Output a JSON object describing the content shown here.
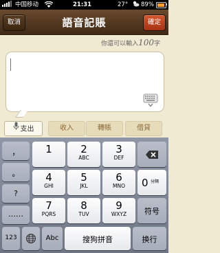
{
  "status_bar": {
    "carrier": "中国移动",
    "time": "21:31",
    "temperature": "27°",
    "battery": "89%",
    "battery_level": 0.89
  },
  "nav": {
    "cancel": "取消",
    "title": "語音記賬",
    "confirm": "確定"
  },
  "hint": {
    "prefix": "你還可以輸入",
    "count": "100",
    "suffix": "字"
  },
  "note": {
    "value": ""
  },
  "type_tabs": {
    "expense": "支出",
    "income": "收入",
    "transfer": "轉賬",
    "loan": "借貸"
  },
  "keyboard": {
    "left_keys": [
      "，",
      "。",
      "?",
      "……"
    ],
    "keys": [
      {
        "num": "1",
        "letters": ""
      },
      {
        "num": "2",
        "letters": "ABC"
      },
      {
        "num": "3",
        "letters": "DEF"
      },
      {
        "num": "4",
        "letters": "GHI"
      },
      {
        "num": "5",
        "letters": "JKL"
      },
      {
        "num": "6",
        "letters": "MNO"
      },
      {
        "num": "7",
        "letters": "PQRS"
      },
      {
        "num": "8",
        "letters": "TUV"
      },
      {
        "num": "9",
        "letters": "WXYZ"
      }
    ],
    "zero": "0",
    "zero_sub": "分隔",
    "symbol": "符号",
    "bottom": {
      "num_mode": "123",
      "abc": "Abc",
      "space": "搜狗拼音",
      "return": "换行"
    },
    "colors": {
      "accent": "#c4451f",
      "nav": "#4f3620"
    }
  }
}
